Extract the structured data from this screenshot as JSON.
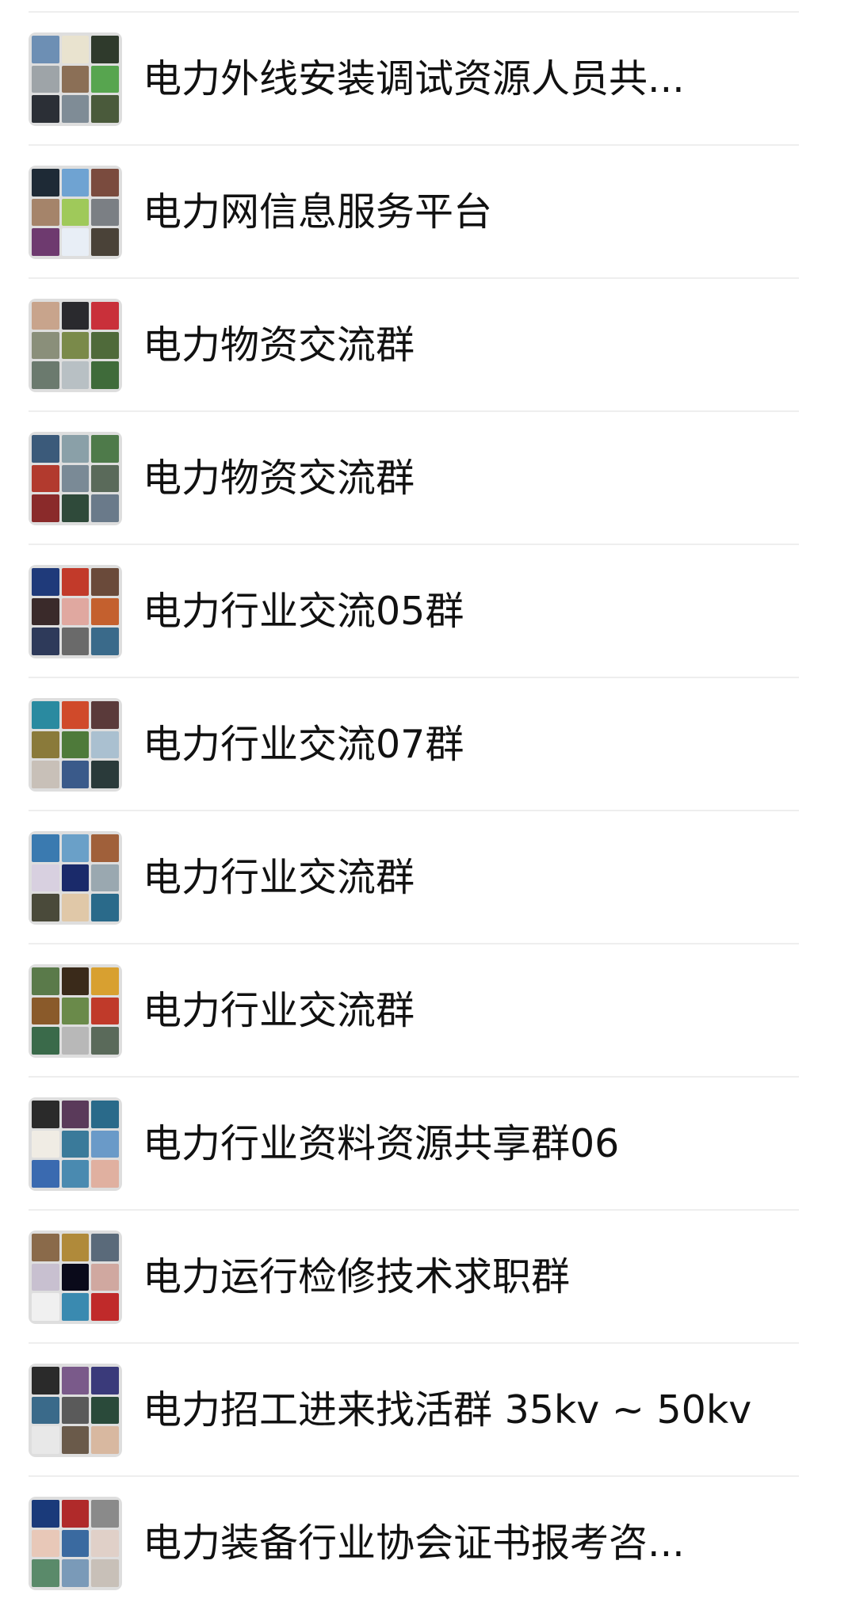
{
  "groups": [
    {
      "name": "电力外线安装调试资源人员共...",
      "avatar": "group-avatar-grid",
      "tiles": [
        "#6d8fb4",
        "#e9e3cf",
        "#2f3a2c",
        "#9ea4a8",
        "#8b6f56",
        "#57a54f",
        "#2b2f36",
        "#7f8c96",
        "#4a5a3b"
      ]
    },
    {
      "name": "电力网信息服务平台",
      "avatar": "group-avatar-grid",
      "tiles": [
        "#1e2a36",
        "#6fa3d2",
        "#7a4b3e",
        "#a5846a",
        "#9fc95a",
        "#7b7f84",
        "#6e3a6f",
        "#e8eef6",
        "#4a4238"
      ]
    },
    {
      "name": "电力物资交流群",
      "avatar": "group-avatar-grid",
      "tiles": [
        "#c8a48c",
        "#2a2a2e",
        "#c9303a",
        "#8a8f7a",
        "#7a8a4a",
        "#4f6a3a",
        "#6b7a6e",
        "#b8c0c4",
        "#3f6b3a"
      ]
    },
    {
      "name": "电力物资交流群",
      "avatar": "group-avatar-grid",
      "tiles": [
        "#3b5a7a",
        "#8aa0a8",
        "#4e7a4a",
        "#b23a2e",
        "#7a8a96",
        "#5a6a5a",
        "#8a2a2a",
        "#2f4a3a",
        "#6a7a8a"
      ]
    },
    {
      "name": "电力行业交流05群",
      "avatar": "group-avatar-grid",
      "tiles": [
        "#1f3a7a",
        "#c23a2a",
        "#6a4a3a",
        "#3a2a2a",
        "#e0a8a0",
        "#c4602e",
        "#2e3a5a",
        "#6a6a6a",
        "#3a6a8a"
      ]
    },
    {
      "name": "电力行业交流07群",
      "avatar": "group-avatar-grid",
      "tiles": [
        "#2a8aa0",
        "#d04a2a",
        "#5a3a3a",
        "#8a7a3a",
        "#4e7a3a",
        "#aac0d0",
        "#c8c0b8",
        "#3a5a8a",
        "#2a3a3a"
      ]
    },
    {
      "name": "电力行业交流群",
      "avatar": "group-avatar-grid",
      "tiles": [
        "#3a7ab0",
        "#6aa0c8",
        "#a0603a",
        "#d8d0e0",
        "#1a2a6a",
        "#9aa8b0",
        "#4a4a3a",
        "#e0c8a8",
        "#2a6a8a"
      ]
    },
    {
      "name": "电力行业交流群",
      "avatar": "group-avatar-grid",
      "tiles": [
        "#5a7a4a",
        "#3a2a1a",
        "#d8a030",
        "#8a5a2a",
        "#6a8a4a",
        "#c03a2a",
        "#3a6a4a",
        "#b8b8b8",
        "#5a6a5a"
      ]
    },
    {
      "name": "电力行业资料资源共享群06",
      "avatar": "group-avatar-grid",
      "tiles": [
        "#2a2a2a",
        "#5a3a5a",
        "#2a6a8a",
        "#f0ece4",
        "#3a7a9a",
        "#6a9ac8",
        "#3a6ab0",
        "#4a8ab0",
        "#e0b0a0"
      ]
    },
    {
      "name": "电力运行检修技术求职群",
      "avatar": "group-avatar-grid",
      "tiles": [
        "#8a6a4a",
        "#b08a3a",
        "#5a6a7a",
        "#c8c0d0",
        "#0a0a1a",
        "#d0a8a0",
        "#f0f0f0",
        "#3a8ab0",
        "#c02a2a"
      ]
    },
    {
      "name": "电力招工进来找活群 35kv ~ 50kv",
      "avatar": "group-avatar-grid",
      "tiles": [
        "#2a2a2a",
        "#7a5a8a",
        "#3a3a7a",
        "#3a6a8a",
        "#5a5a5a",
        "#2a4a3a",
        "#e8e8e8",
        "#6a5a4a",
        "#d8b8a0"
      ]
    },
    {
      "name": "电力装备行业协会证书报考咨...",
      "avatar": "group-avatar-grid",
      "tiles": [
        "#1a3a7a",
        "#b02a2a",
        "#8a8a8a",
        "#e8c8b8",
        "#3a6aa0",
        "#e0d0c8",
        "#5a8a6a",
        "#7a9ab8",
        "#c8c0b8"
      ]
    }
  ]
}
